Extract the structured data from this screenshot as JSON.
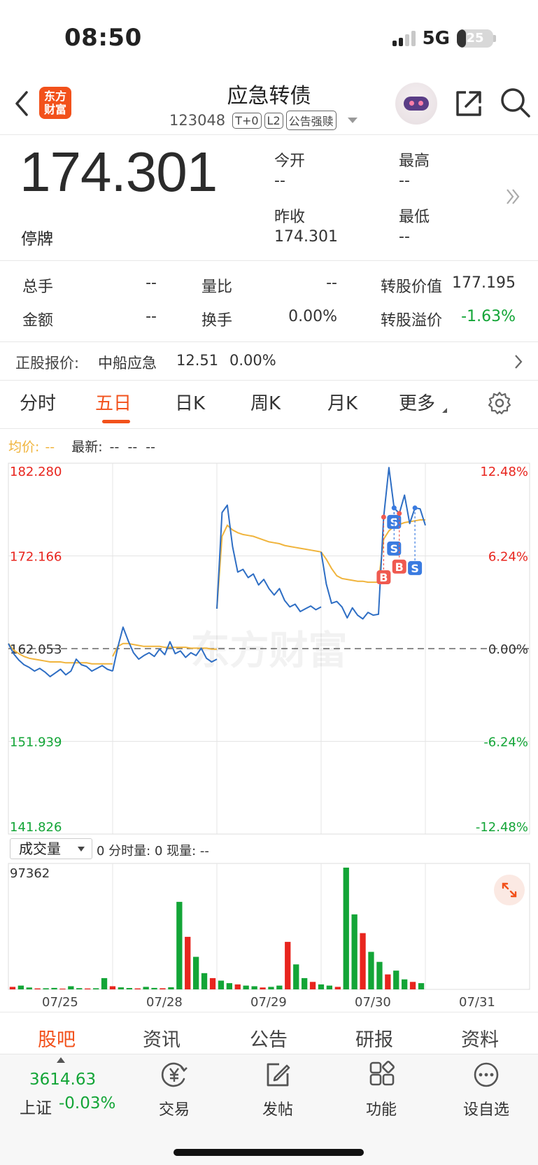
{
  "status_bar": {
    "time": "08:50",
    "network": "5G",
    "battery": 25
  },
  "header": {
    "title": "应急转债",
    "code": "123048",
    "tags": [
      "T+0",
      "L2",
      "公告强赎"
    ],
    "logo_text": "东方财富",
    "icons": {
      "back": "back-arrow-icon",
      "share": "share-icon",
      "search": "search-icon",
      "assistant": "robot-avatar-icon"
    }
  },
  "quote": {
    "price": "174.301",
    "status": "停牌",
    "fields": [
      {
        "label": "今开",
        "value": "--"
      },
      {
        "label": "最高",
        "value": "--"
      },
      {
        "label": "昨收",
        "value": "174.301"
      },
      {
        "label": "最低",
        "value": "--"
      }
    ]
  },
  "stats": [
    {
      "label": "总手",
      "value": "--"
    },
    {
      "label": "量比",
      "value": "--"
    },
    {
      "label": "转股价值",
      "value": "177.195"
    },
    {
      "label": "金额",
      "value": "--"
    },
    {
      "label": "换手",
      "value": "0.00%"
    },
    {
      "label": "转股溢价",
      "value": "-1.63%"
    }
  ],
  "underlying": {
    "label": "正股报价:",
    "name": "中船应急",
    "price": "12.51",
    "change": "0.00%"
  },
  "chart_tabs": [
    "分时",
    "五日",
    "日K",
    "周K",
    "月K",
    "更多"
  ],
  "active_chart_tab": "五日",
  "chart_info": {
    "avg_label": "均价:",
    "avg_value": "--",
    "latest_label": "最新:",
    "latest_value": "--  --  --"
  },
  "volume_panel": {
    "selector": "成交量",
    "info": "0 分时量: 0 现量: --",
    "max_label": "97362"
  },
  "bottom_tabs": [
    "股吧",
    "资讯",
    "公告",
    "研报",
    "资料"
  ],
  "active_bottom_tab": "股吧",
  "dock": {
    "index_value": "3614.63",
    "index_name": "上证",
    "index_change": "-0.03%",
    "items": [
      {
        "label": "交易",
        "icon": "yuan-trade-icon"
      },
      {
        "label": "发帖",
        "icon": "edit-post-icon"
      },
      {
        "label": "功能",
        "icon": "grid-function-icon"
      },
      {
        "label": "设自选",
        "icon": "more-dots-icon"
      }
    ]
  },
  "colors": {
    "accent": "#f2511b",
    "up": "#e8251e",
    "down": "#13a537",
    "price_line": "#2e6ec4",
    "avg_line": "#f0b43c"
  },
  "chart_data": {
    "type": "line",
    "x_labels": [
      "07/25",
      "07/28",
      "07/29",
      "07/30",
      "07/31"
    ],
    "y_left_ticks": [
      "182.280",
      "172.166",
      "162.053",
      "151.939",
      "141.826"
    ],
    "y_right_ticks": [
      "12.48%",
      "6.24%",
      "0.00%",
      "-6.24%",
      "-12.48%"
    ],
    "ylim": [
      141.826,
      182.28
    ],
    "baseline": 162.053,
    "watermark": "东方财富",
    "series": [
      {
        "day": "07/25",
        "price": [
          162.6,
          161.5,
          160.8,
          160.3,
          160.0,
          159.6,
          159.9,
          159.5,
          159.0,
          159.4,
          159.8,
          159.2,
          159.6,
          160.9,
          160.3,
          160.1,
          159.6,
          159.9,
          160.2,
          159.8,
          159.6
        ],
        "avg": [
          162.6,
          161.9,
          161.5,
          161.2,
          161.0,
          160.9,
          160.8,
          160.7,
          160.6,
          160.6,
          160.6,
          160.5,
          160.5,
          160.5,
          160.5,
          160.5,
          160.4,
          160.4,
          160.4,
          160.4,
          160.4
        ]
      },
      {
        "day": "07/28",
        "price": [
          159.6,
          162.2,
          164.4,
          162.9,
          161.6,
          160.9,
          161.3,
          161.6,
          161.2,
          162.0,
          161.4,
          162.8,
          161.5,
          161.8,
          161.1,
          161.6,
          161.3,
          162.1,
          161.0,
          160.6,
          160.9
        ],
        "avg": [
          161.2,
          162.3,
          162.6,
          162.6,
          162.5,
          162.4,
          162.3,
          162.3,
          162.3,
          162.3,
          162.2,
          162.2,
          162.2,
          162.2,
          162.2,
          162.1,
          162.1,
          162.1,
          162.1,
          162.0,
          162.0
        ]
      },
      {
        "day": "07/29",
        "price": [
          166.4,
          176.9,
          177.7,
          173.2,
          170.4,
          170.7,
          169.8,
          170.2,
          169.0,
          169.6,
          168.6,
          167.9,
          168.6,
          167.3,
          166.6,
          166.9,
          166.1,
          166.4,
          166.7,
          166.3,
          166.6
        ],
        "avg": [
          166.4,
          174.3,
          175.5,
          175.0,
          174.7,
          174.5,
          174.4,
          174.3,
          174.1,
          173.9,
          173.7,
          173.6,
          173.5,
          173.3,
          173.2,
          173.1,
          173.0,
          172.9,
          172.8,
          172.7,
          172.6
        ]
      },
      {
        "day": "07/30",
        "price": [
          172.6,
          169.1,
          167.0,
          167.2,
          166.6,
          165.4,
          166.5,
          165.7,
          165.3,
          166.0,
          165.7,
          165.8,
          176.4,
          181.8,
          177.4,
          176.8,
          178.8,
          175.7,
          177.4,
          177.3,
          175.5
        ],
        "avg": [
          172.6,
          171.8,
          170.8,
          170.0,
          169.7,
          169.6,
          169.5,
          169.4,
          169.4,
          169.3,
          169.3,
          169.3,
          174.0,
          174.9,
          175.4,
          175.6,
          175.8,
          175.9,
          176.0,
          176.1,
          176.1
        ]
      }
    ],
    "trade_markers": [
      "S",
      "S",
      "B",
      "B",
      "S"
    ],
    "volume": {
      "max": 97362,
      "values": [
        2000,
        3000,
        1500,
        800,
        900,
        1200,
        600,
        2500,
        1000,
        700,
        900,
        9000,
        2500,
        1600,
        1100,
        800,
        2000,
        1200,
        900,
        1700,
        70000,
        42000,
        26000,
        13000,
        9000,
        7000,
        5000,
        4000,
        3000,
        2500,
        1500,
        2000,
        3000,
        38000,
        20000,
        9000,
        6000,
        4000,
        3000,
        2000,
        97362,
        60000,
        45000,
        30000,
        22000,
        12000,
        15000,
        8000,
        6000,
        5000
      ]
    }
  }
}
